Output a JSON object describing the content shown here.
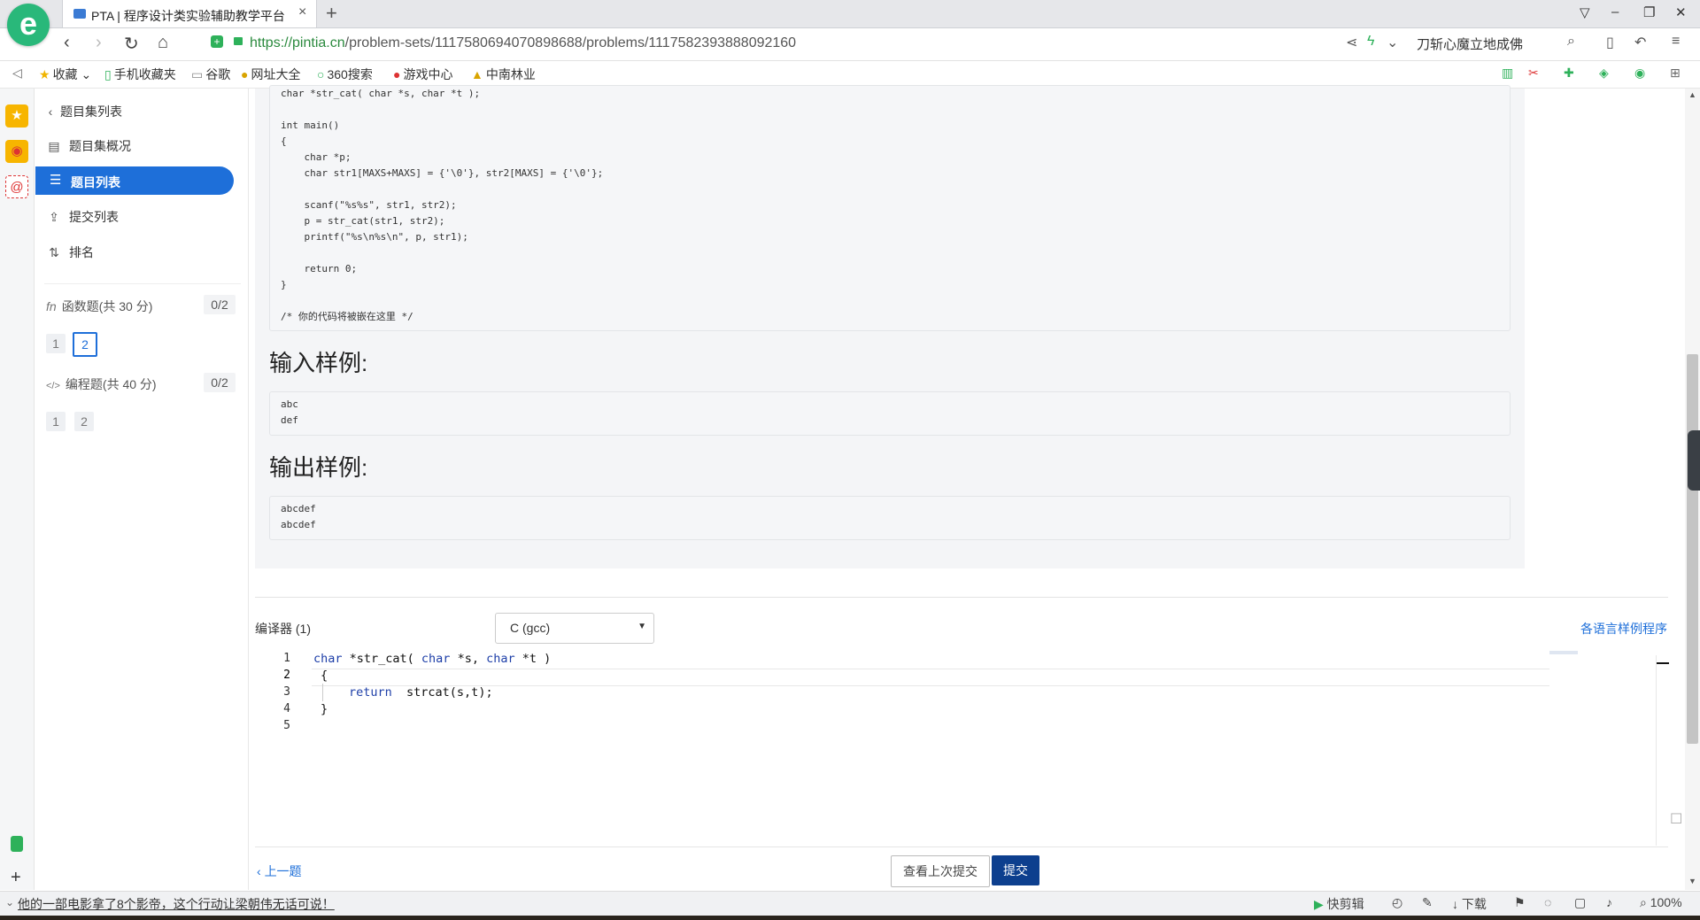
{
  "browser": {
    "tab_title": "PTA | 程序设计类实验辅助教学平台",
    "tab_close": "×",
    "new_tab": "+",
    "url_scheme": "https://",
    "url_host": "pintia.cn",
    "url_path": "/problem-sets/1117580694070898688/problems/1117582393888092160",
    "search_box_text": "刀斩心魔立地成佛",
    "bookmarks": [
      "收藏",
      "手机收藏夹",
      "谷歌",
      "网址大全",
      "360搜索",
      "游戏中心",
      "中南林业"
    ],
    "zoom": "100%",
    "status_news": "他的一部电影拿了8个影帝，这个行动让梁朝伟无话可说！",
    "status_items": [
      "快剪辑",
      "下载"
    ]
  },
  "sidebar": {
    "back_label": "题目集列表",
    "items": [
      {
        "label": "题目集概况",
        "icon": "book-icon"
      },
      {
        "label": "题目列表",
        "icon": "list-icon",
        "active": true
      },
      {
        "label": "提交列表",
        "icon": "upload-icon"
      },
      {
        "label": "排名",
        "icon": "sort-icon"
      }
    ],
    "sections": [
      {
        "label": "函数题(共 30 分)",
        "score": "0/2",
        "icon": "fn",
        "questions": [
          "1",
          "2"
        ],
        "current": "2"
      },
      {
        "label": "编程题(共 40 分)",
        "score": "0/2",
        "icon": "</>",
        "questions": [
          "1",
          "2"
        ]
      }
    ]
  },
  "problem": {
    "code_lines": [
      "char *str_cat( char *s, char *t );",
      "",
      "int main()",
      "{",
      "    char *p;",
      "    char str1[MAXS+MAXS] = {'\\0'}, str2[MAXS] = {'\\0'};",
      "",
      "    scanf(\"%s%s\", str1, str2);",
      "    p = str_cat(str1, str2);",
      "    printf(\"%s\\n%s\\n\", p, str1);",
      "",
      "    return 0;",
      "}",
      "",
      "/* 你的代码将被嵌在这里 */"
    ],
    "input_heading": "输入样例:",
    "input_lines": [
      "abc",
      "def"
    ],
    "output_heading": "输出样例:",
    "output_lines": [
      "abcdef",
      "abcdef"
    ]
  },
  "editor": {
    "compiler_label": "编译器 (1)",
    "language": "C (gcc)",
    "samples_link": "各语言样例程序",
    "line_numbers": [
      "1",
      "2",
      "3",
      "4",
      "5"
    ],
    "prev_label": "上一题",
    "view_last_label": "查看上次提交",
    "submit_label": "提交"
  },
  "colors": {
    "accent": "#1e6fd9",
    "submit": "#0d3f8e",
    "brand_green": "#29b87a"
  }
}
